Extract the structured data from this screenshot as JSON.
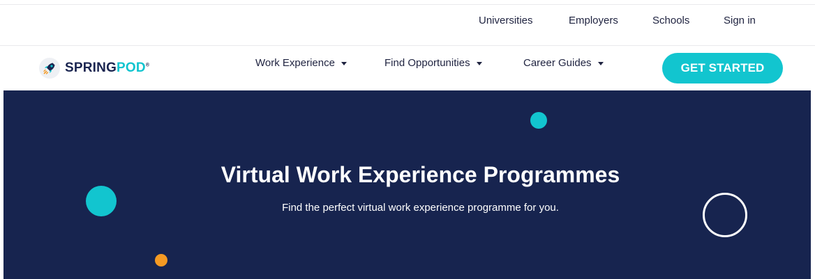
{
  "utility_nav": {
    "links": [
      {
        "label": "Universities"
      },
      {
        "label": "Employers"
      },
      {
        "label": "Schools"
      },
      {
        "label": "Sign in"
      }
    ]
  },
  "brand": {
    "name_main": "SPRING",
    "name_accent": "POD",
    "registered_mark": "®",
    "icon": "rocket-icon"
  },
  "main_nav": {
    "items": [
      {
        "label": "Work Experience",
        "icon": "caret-down-icon"
      },
      {
        "label": "Find Opportunities",
        "icon": "caret-down-icon"
      },
      {
        "label": "Career Guides",
        "icon": "caret-down-icon"
      }
    ],
    "cta_label": "GET STARTED"
  },
  "hero": {
    "title": "Virtual Work Experience Programmes",
    "subtitle": "Find the perfect virtual work experience programme for you."
  },
  "colors": {
    "navy": "#17244f",
    "teal": "#12c5cf",
    "orange": "#f59a23",
    "white": "#ffffff",
    "text_dark": "#1f2340"
  }
}
